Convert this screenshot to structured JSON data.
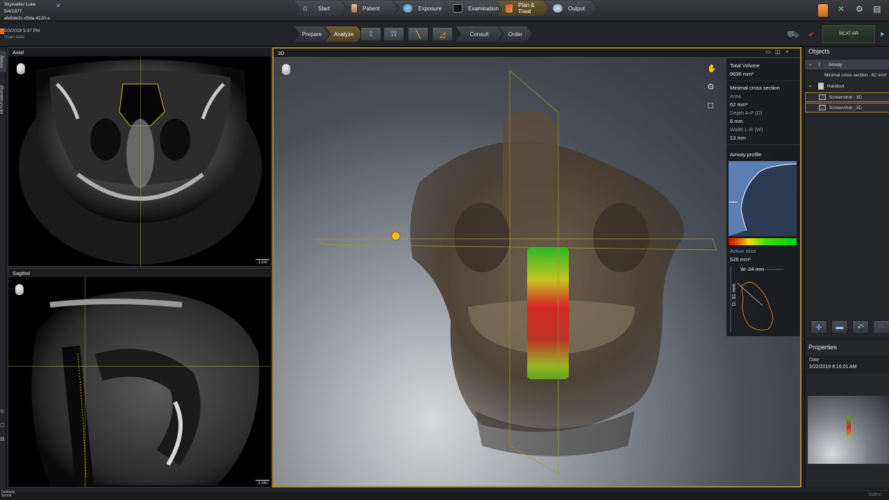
{
  "patient": {
    "name": "Skywalker Luke",
    "dob": "5/4/1977",
    "id": "afe8de2c-d5da-4120-a"
  },
  "workflow": {
    "steps": [
      {
        "label": "Start",
        "icon": "home-icon",
        "active": false
      },
      {
        "label": "Patient",
        "icon": "patient-icon",
        "active": false
      },
      {
        "label": "Exposure",
        "icon": "exposure-icon",
        "active": false
      },
      {
        "label": "Examination",
        "icon": "examination-icon",
        "active": false
      },
      {
        "label": "Plan & Treat",
        "icon": "plan-treat-icon",
        "active": true
      },
      {
        "label": "Output",
        "icon": "output-icon",
        "active": false
      }
    ]
  },
  "scan": {
    "date": "5/3/2019 5:37 PM",
    "label": "Scan date"
  },
  "substeps": {
    "prepare": "Prepare",
    "analyze": "Analyze",
    "consult": "Consult",
    "order": "Order"
  },
  "sicat_button": "SICAT AIR",
  "sidebar_tabs": [
    "Airway",
    "MPR/Radiology"
  ],
  "views": {
    "axial": {
      "title": "Axial",
      "scale": "1 cm"
    },
    "sagittal": {
      "title": "Sagittal",
      "scale": "1 cm"
    },
    "three_d": {
      "title": "3D"
    }
  },
  "airway_info": {
    "total_volume_label": "Total Volume",
    "total_volume_value": "9696 mm³",
    "min_cross_title": "Minimal cross section",
    "area_label": "Area",
    "area_value": "62 mm²",
    "depth_label": "Depth A-P (D)",
    "depth_value": "6 mm",
    "width_label": "Width L-R (W)",
    "width_value": "13 mm",
    "profile_title": "Airway profile",
    "active_slice_label": "Active slice",
    "active_slice_value": "526 mm²",
    "w_label": "W: 24 mm",
    "d_label": "D: 31 mm"
  },
  "objects": {
    "title": "Objects",
    "items": [
      {
        "label": "Airway",
        "level": 0
      },
      {
        "label": "Minimal cross section - 62 mm²",
        "level": 1
      },
      {
        "label": "Handout",
        "level": 0
      },
      {
        "label": "Screenshot - 3D",
        "level": 1
      },
      {
        "label": "Screenshot - 3D",
        "level": 1
      }
    ]
  },
  "properties": {
    "title": "Properties",
    "date_label": "Date",
    "date_value": "5/22/2019 8:16:01 AM"
  },
  "footer": {
    "brand_line1": "Dentsply",
    "brand_line2": "Sirona",
    "brand_right": "Sidexi"
  },
  "colors": {
    "accent": "#a88a2e",
    "gradient_red": "#e00000",
    "gradient_yellow": "#f0e000",
    "gradient_green": "#00d000"
  }
}
